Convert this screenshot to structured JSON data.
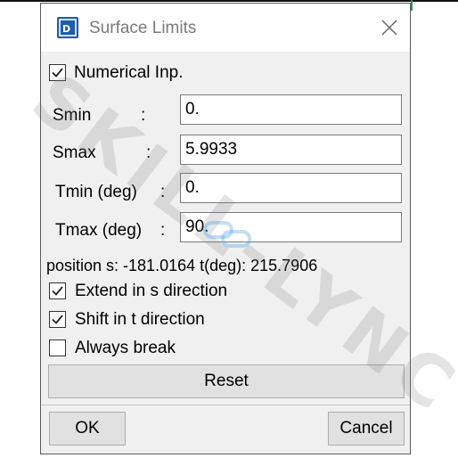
{
  "window": {
    "title": "Surface Limits",
    "app_icon": "app-logo-icon",
    "close_icon": "close-icon",
    "accent": "#1d5fae"
  },
  "numerical_input": {
    "label": "Numerical Inp.",
    "checked": true
  },
  "fields": [
    {
      "label": "Smin",
      "separator": ":",
      "value": "0."
    },
    {
      "label": "Smax",
      "separator": ":",
      "value": "5.9933"
    },
    {
      "label": "Tmin (deg)",
      "separator": ":",
      "value": "0."
    },
    {
      "label": "Tmax (deg)",
      "separator": ":",
      "value": "90."
    }
  ],
  "position_readout": "position s: -181.0164  t(deg): 215.7906",
  "options": [
    {
      "label": "Extend in s direction",
      "checked": true
    },
    {
      "label": "Shift in t direction",
      "checked": true
    },
    {
      "label": "Always break",
      "checked": false
    }
  ],
  "buttons": {
    "reset": "Reset",
    "ok": "OK",
    "cancel": "Cancel"
  },
  "watermark": {
    "text": "SKILL-LYNC",
    "icon": "link-icon"
  }
}
